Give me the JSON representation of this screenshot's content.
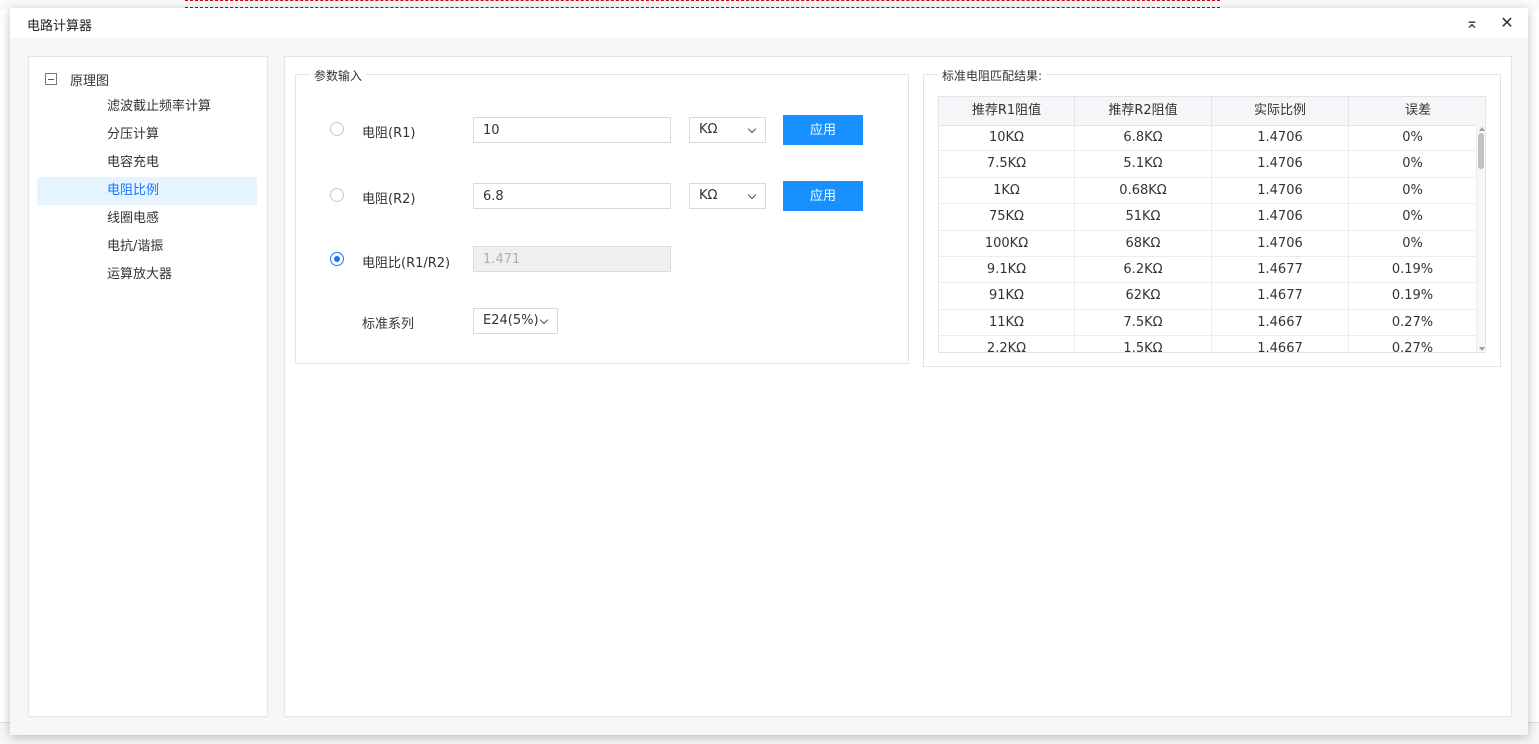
{
  "dialog": {
    "title": "电路计算器",
    "collapse_glyph": "⌅",
    "close_glyph": "✕"
  },
  "tree": {
    "root_label": "原理图",
    "items": [
      {
        "label": "滤波截止频率计算",
        "active": false
      },
      {
        "label": "分压计算",
        "active": false
      },
      {
        "label": "电容充电",
        "active": false
      },
      {
        "label": "电阻比例",
        "active": true
      },
      {
        "label": "线圈电感",
        "active": false
      },
      {
        "label": "电抗/谐振",
        "active": false
      },
      {
        "label": "运算放大器",
        "active": false
      }
    ]
  },
  "params": {
    "legend": "参数输入",
    "r1": {
      "label": "电阻(R1)",
      "value": "10",
      "unit": "KΩ",
      "apply_label": "应用",
      "selected": false
    },
    "r2": {
      "label": "电阻(R2)",
      "value": "6.8",
      "unit": "KΩ",
      "apply_label": "应用",
      "selected": false
    },
    "ratio": {
      "label": "电阻比(R1/R2)",
      "value": "1.471",
      "selected": true
    },
    "series": {
      "label": "标准系列",
      "value": "E24(5%)"
    }
  },
  "results": {
    "legend": "标准电阻匹配结果:",
    "headers": [
      "推荐R1阻值",
      "推荐R2阻值",
      "实际比例",
      "误差"
    ],
    "rows": [
      [
        "10KΩ",
        "6.8KΩ",
        "1.4706",
        "0%"
      ],
      [
        "7.5KΩ",
        "5.1KΩ",
        "1.4706",
        "0%"
      ],
      [
        "1KΩ",
        "0.68KΩ",
        "1.4706",
        "0%"
      ],
      [
        "75KΩ",
        "51KΩ",
        "1.4706",
        "0%"
      ],
      [
        "100KΩ",
        "68KΩ",
        "1.4706",
        "0%"
      ],
      [
        "9.1KΩ",
        "6.2KΩ",
        "1.4677",
        "0.19%"
      ],
      [
        "91KΩ",
        "62KΩ",
        "1.4677",
        "0.19%"
      ],
      [
        "11KΩ",
        "7.5KΩ",
        "1.4667",
        "0.27%"
      ],
      [
        "2.2KΩ",
        "1.5KΩ",
        "1.4667",
        "0.27%"
      ]
    ]
  },
  "colors": {
    "accent": "#1890ff",
    "active_bg": "#e6f4ff",
    "active_text": "#1677ff"
  }
}
